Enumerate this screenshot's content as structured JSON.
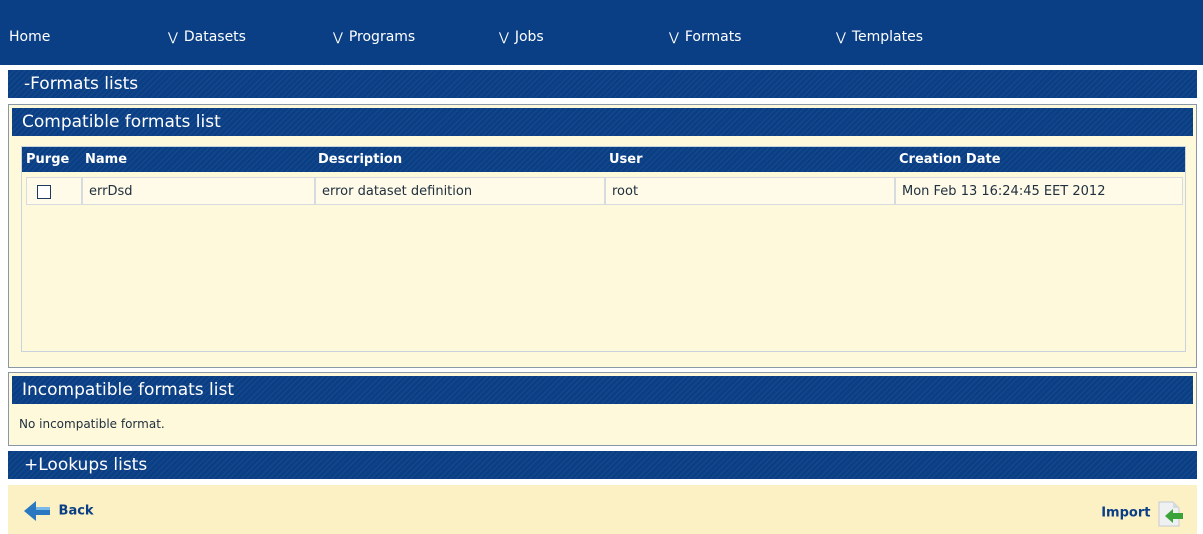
{
  "nav": {
    "home": "Home",
    "items": [
      {
        "label": "Datasets",
        "icon": "double-chevron-down-icon"
      },
      {
        "label": "Programs",
        "icon": "double-chevron-down-icon"
      },
      {
        "label": "Jobs",
        "icon": "double-chevron-down-icon"
      },
      {
        "label": "Formats",
        "icon": "double-chevron-down-icon"
      },
      {
        "label": "Templates",
        "icon": "double-chevron-down-icon"
      }
    ]
  },
  "formats_lists": {
    "title": "-Formats lists",
    "compatible": {
      "title": "Compatible formats list",
      "columns": [
        "Purge",
        "Name",
        "Description",
        "User",
        "Creation Date"
      ],
      "rows": [
        {
          "purge": false,
          "name": "errDsd",
          "description": "error dataset definition",
          "user": "root",
          "creation_date": "Mon Feb 13 16:24:45 EET 2012"
        }
      ]
    },
    "incompatible": {
      "title": "Incompatible formats list",
      "message": "No incompatible format."
    }
  },
  "lookups_lists": {
    "title": "+Lookups lists"
  },
  "footer": {
    "back_label": "Back",
    "import_label": "Import"
  },
  "colors": {
    "navy": "#0b3f85",
    "panel_bg": "#fff9dc",
    "footer_bg": "#fbf1c4"
  }
}
